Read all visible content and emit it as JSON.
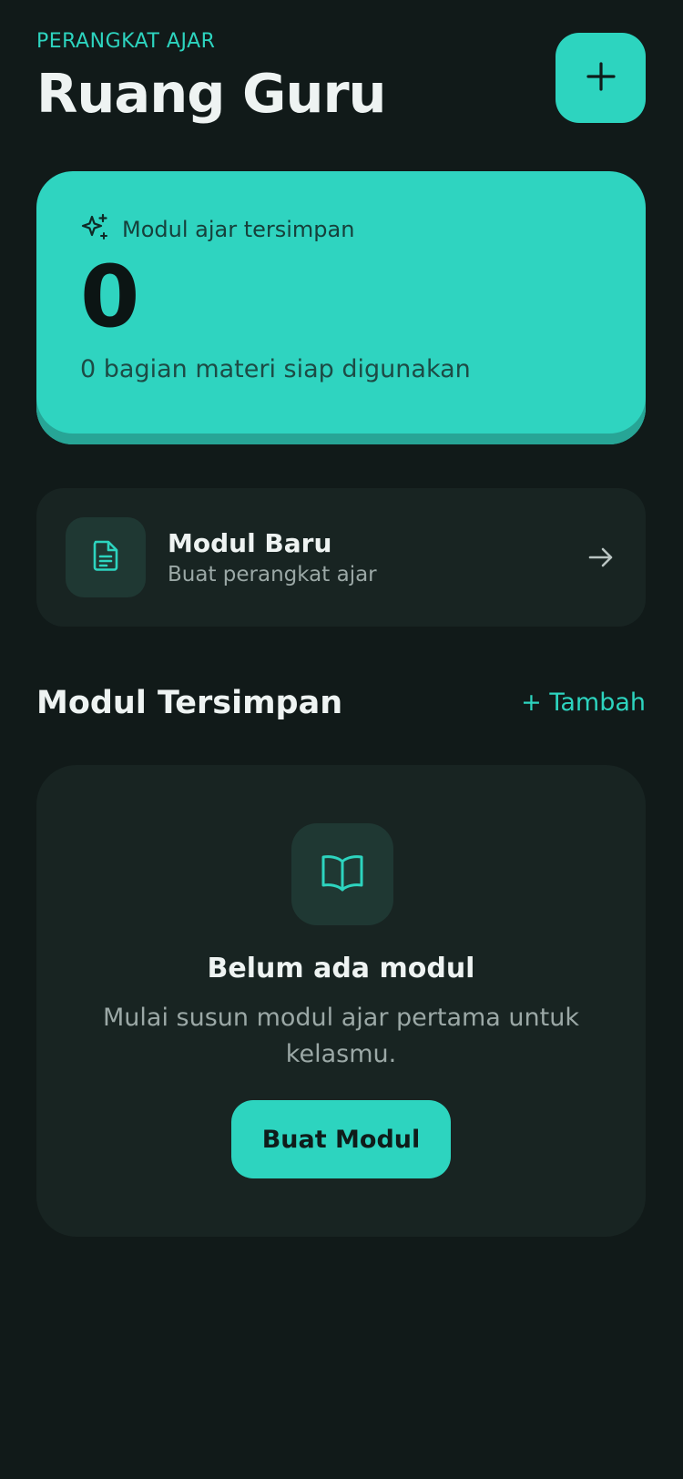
{
  "header": {
    "eyebrow": "PERANGKAT AJAR",
    "title": "Ruang Guru",
    "add_button_icon": "plus-icon"
  },
  "hero": {
    "icon": "sparkles-icon",
    "label": "Modul ajar tersimpan",
    "count": "0",
    "subtitle": "0 bagian materi siap digunakan"
  },
  "new_module": {
    "icon": "document-icon",
    "title": "Modul Baru",
    "subtitle": "Buat perangkat ajar",
    "arrow_icon": "arrow-right-icon"
  },
  "saved_section": {
    "title": "Modul Tersimpan",
    "action": "+ Tambah"
  },
  "empty_state": {
    "icon": "open-book-icon",
    "title": "Belum ada modul",
    "description": "Mulai susun modul ajar pertama untuk kelasmu.",
    "button": "Buat Modul"
  },
  "colors": {
    "background": "#111a19",
    "accent": "#2dd4bf",
    "card": "#182422",
    "text": "#eef3f2",
    "muted": "#9ba8a6"
  }
}
